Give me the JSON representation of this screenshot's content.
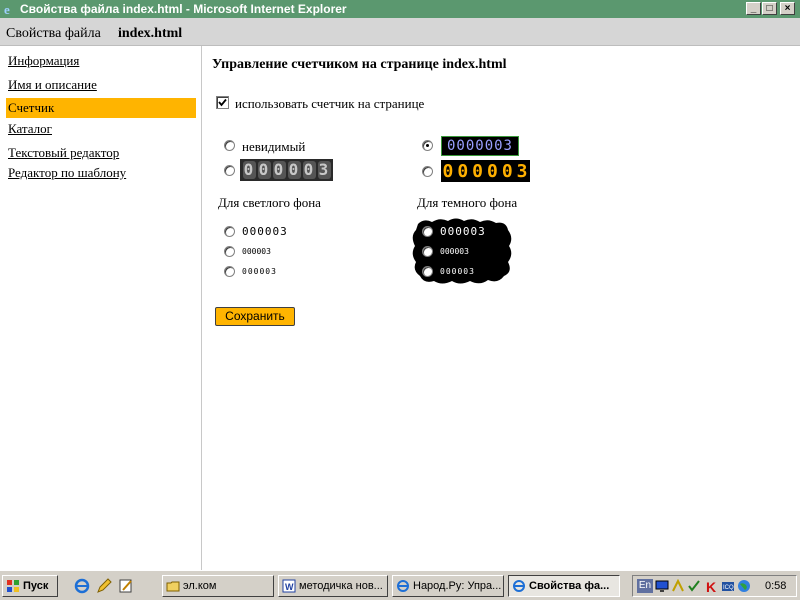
{
  "window": {
    "title": "Свойства файла index.html - Microsoft Internet Explorer",
    "minimize_glyph": "_",
    "maximize_glyph": "□",
    "close_glyph": "×"
  },
  "header": {
    "prefix": "Свойства файла",
    "filename": "index.html"
  },
  "sidebar": {
    "items": [
      {
        "label": "Информация",
        "active": false
      },
      {
        "label": "Имя и описание",
        "active": false
      },
      {
        "label": "Счетчик",
        "active": true
      },
      {
        "label": "Каталог",
        "active": false
      },
      {
        "label": "Текстовый редактор",
        "active": false
      },
      {
        "label": "Редактор по шаблону",
        "active": false
      }
    ]
  },
  "main": {
    "heading": "Управление счетчиком на странице index.html",
    "use_counter_label": "использовать счетчик на странице",
    "use_counter_checked": true,
    "invisible_label": "невидимый",
    "counter_gray_digits": "000003",
    "counter_blue_digits": "0000003",
    "counter_orange_digits": "000003",
    "light_bg_label": "Для светлого фона",
    "dark_bg_label": "Для темного фона",
    "mini_large": "000003",
    "mini_medium": "000003",
    "mini_small": "000003",
    "save_label": "Сохранить",
    "colors": {
      "accent": "#ffb400",
      "titlebar": "#5b986f",
      "counter_orange": "#ffb000",
      "counter_blue": "#9aa0ff"
    }
  },
  "taskbar": {
    "start_label": "Пуск",
    "buttons": [
      {
        "label": "эл.ком",
        "icon": "folder-icon"
      },
      {
        "label": "методичка нов...",
        "icon": "word-icon"
      },
      {
        "label": "Народ.Ру: Упра...",
        "icon": "ie-icon"
      },
      {
        "label": "Свойства фа...",
        "icon": "ie-icon",
        "pressed": true
      }
    ],
    "tray": {
      "lang": "En",
      "time": "0:58"
    }
  }
}
